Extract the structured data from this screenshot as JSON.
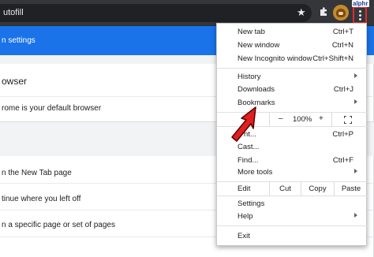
{
  "browser": {
    "omnibox_text": "utofill",
    "star_icon": "star-icon",
    "extensions_icon": "puzzle-icon",
    "watermark": "alphr"
  },
  "page": {
    "banner_text": "n settings",
    "default_browser_heading": "owser",
    "default_browser_row": "rome is your default browser",
    "startup_options": [
      "n the New Tab page",
      "tinue where you left off",
      "n a specific page or set of pages"
    ]
  },
  "menu": {
    "group1": [
      {
        "label": "New tab",
        "shortcut": "Ctrl+T"
      },
      {
        "label": "New window",
        "shortcut": "Ctrl+N"
      },
      {
        "label": "New Incognito window",
        "shortcut": "Ctrl+Shift+N"
      }
    ],
    "group2": [
      {
        "label": "History",
        "submenu": true
      },
      {
        "label": "Downloads",
        "shortcut": "Ctrl+J"
      },
      {
        "label": "Bookmarks",
        "submenu": true
      }
    ],
    "zoom": {
      "minus": "–",
      "value": "100%",
      "plus": "+"
    },
    "group3": [
      {
        "label": "nt...",
        "shortcut": "Ctrl+P"
      },
      {
        "label": "Cast..."
      },
      {
        "label": "Find...",
        "shortcut": "Ctrl+F"
      },
      {
        "label": "More tools",
        "submenu": true
      }
    ],
    "edit": {
      "label": "Edit",
      "cut": "Cut",
      "copy": "Copy",
      "paste": "Paste"
    },
    "group4": [
      {
        "label": "Settings"
      },
      {
        "label": "Help",
        "submenu": true
      }
    ],
    "exit": "Exit"
  },
  "colors": {
    "toolbar": "#35363a",
    "accent": "#1a73e8",
    "highlight": "#e12b2b"
  }
}
